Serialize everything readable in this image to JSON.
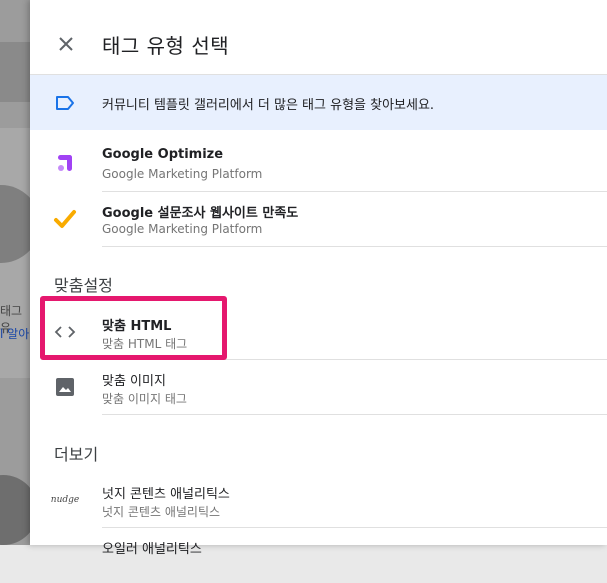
{
  "header": {
    "title": "태그 유형 선택"
  },
  "banner": {
    "text": "커뮤니티 템플릿 갤러리에서 더 많은 태그 유형을 찾아보세요."
  },
  "featured": [
    {
      "name": "Google Optimize",
      "subtitle": "Google Marketing Platform",
      "icon": "optimize-icon",
      "color": "#a142f4"
    },
    {
      "name": "Google 설문조사 웹사이트 만족도",
      "subtitle": "Google Marketing Platform",
      "icon": "checkmark-icon",
      "color": "#f9ab00"
    }
  ],
  "custom_section": {
    "heading": "맞춤설정",
    "items": [
      {
        "name": "맞춤 HTML",
        "subtitle": "맞춤 HTML 태그",
        "icon": "code-icon"
      },
      {
        "name": "맞춤 이미지",
        "subtitle": "맞춤 이미지 태그",
        "icon": "image-icon"
      }
    ]
  },
  "more_section": {
    "heading": "더보기",
    "items": [
      {
        "name": "넛지 콘텐츠 애널리틱스",
        "subtitle": "넛지 콘텐츠 애널리틱스",
        "icon": "nudge-logo",
        "logo_text": "nudge"
      },
      {
        "name": "오일러 애널리틱스",
        "icon": "analytics-icon"
      }
    ]
  },
  "background": {
    "text_line1": "태그 유",
    "text_line2": "l 알아"
  },
  "colors": {
    "highlight": "#e5186e",
    "banner_bg": "#e8f0fe",
    "banner_icon": "#1a73e8"
  }
}
